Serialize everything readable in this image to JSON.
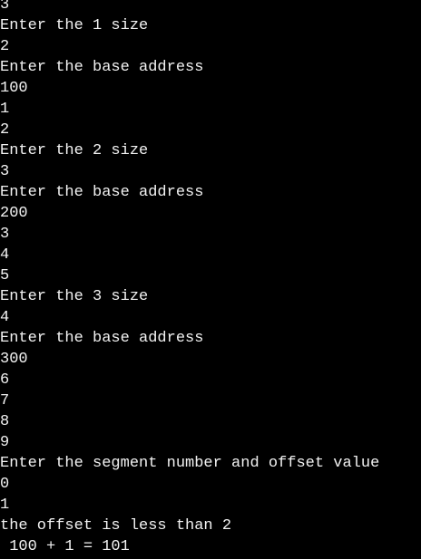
{
  "console": {
    "lines": [
      "3",
      "Enter the 1 size",
      "2",
      "Enter the base address",
      "100",
      "1",
      "2",
      "Enter the 2 size",
      "3",
      "Enter the base address",
      "200",
      "3",
      "4",
      "5",
      "Enter the 3 size",
      "4",
      "Enter the base address",
      "300",
      "6",
      "7",
      "8",
      "9",
      "Enter the segment number and offset value",
      "0",
      "1",
      "the offset is less than 2",
      " 100 + 1 = 101"
    ]
  },
  "colors": {
    "background": "#000000",
    "text": "#f2f2f2"
  }
}
